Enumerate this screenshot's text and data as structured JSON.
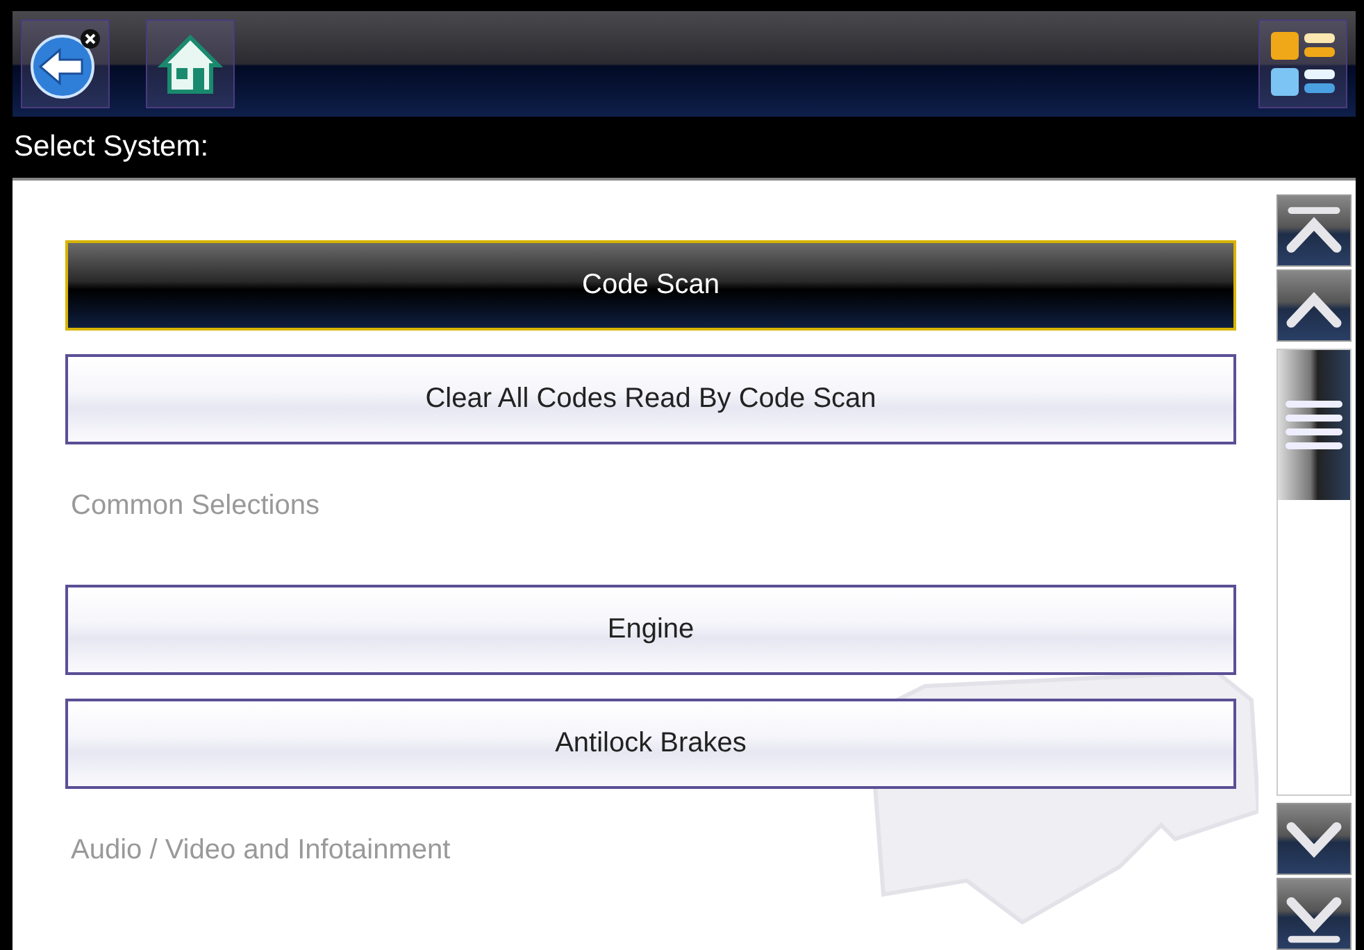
{
  "header": {
    "title": "Select System:"
  },
  "items": [
    {
      "kind": "button",
      "label": "Code Scan",
      "selected": true
    },
    {
      "kind": "button",
      "label": "Clear All Codes Read By Code Scan",
      "selected": false
    },
    {
      "kind": "heading",
      "label": "Common Selections"
    },
    {
      "kind": "button",
      "label": "Engine",
      "selected": false
    },
    {
      "kind": "button",
      "label": "Antilock Brakes",
      "selected": false
    },
    {
      "kind": "heading",
      "label": "Audio / Video and Infotainment"
    }
  ]
}
